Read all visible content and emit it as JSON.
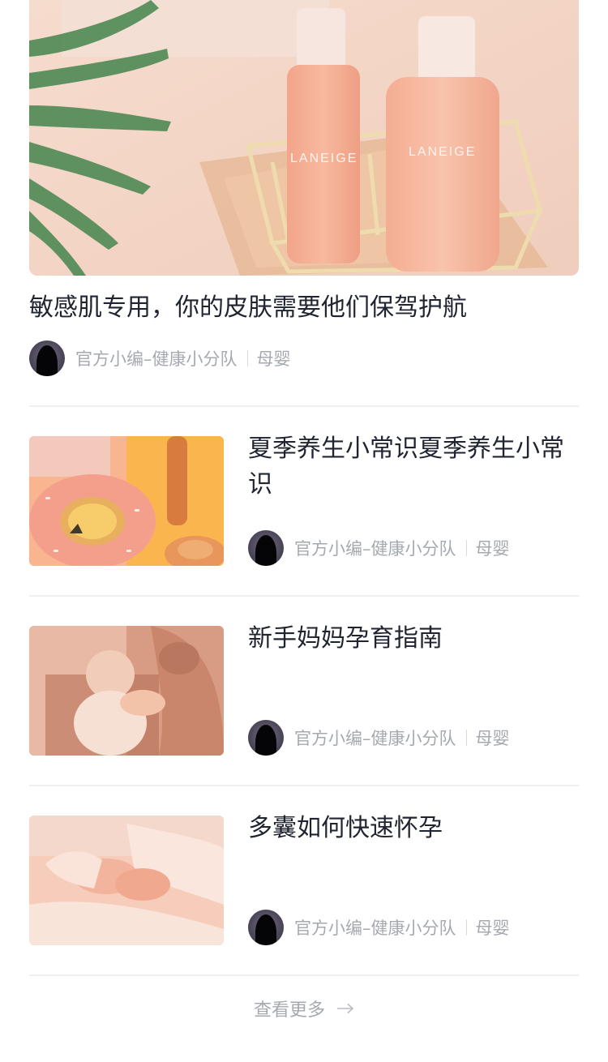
{
  "featured": {
    "title": "敏感肌专用，你的皮肤需要他们保驾护航",
    "author": "官方小编–健康小分队",
    "category": "母婴",
    "image_text": "LANEIGE"
  },
  "articles": [
    {
      "title": "夏季养生小常识夏季养生小常识",
      "author": "官方小编–健康小分队",
      "category": "母婴"
    },
    {
      "title": "新手妈妈孕育指南",
      "author": "官方小编–健康小分队",
      "category": "母婴"
    },
    {
      "title": "多囊如何快速怀孕",
      "author": "官方小编–健康小分队",
      "category": "母婴"
    }
  ],
  "footer": {
    "more_label": "查看更多",
    "more_icon": "arrow-right-icon"
  },
  "colors": {
    "title": "#1f2430",
    "meta": "#a5a9b0",
    "divider": "#eeeff1"
  }
}
